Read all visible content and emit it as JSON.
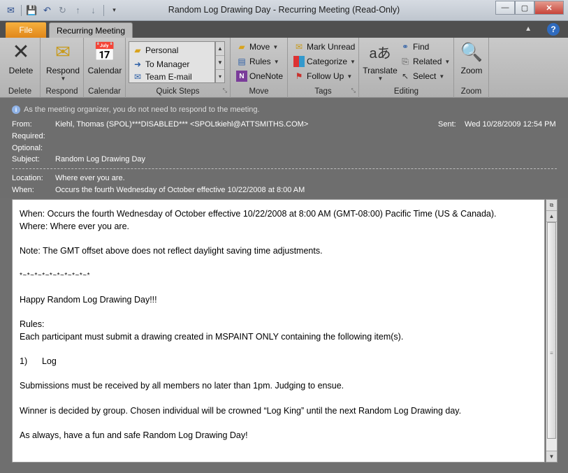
{
  "window": {
    "title": "Random Log Drawing Day  -  Recurring Meeting  (Read-Only)",
    "controls": {
      "minimize": "—",
      "maximize": "▢",
      "close": "✕"
    }
  },
  "tabs": {
    "file": "File",
    "active": "Recurring Meeting",
    "help": "?"
  },
  "ribbon": {
    "delete": {
      "button": "Delete",
      "group": "Delete"
    },
    "respond": {
      "button": "Respond",
      "group": "Respond"
    },
    "calendar": {
      "button": "Calendar",
      "group": "Calendar"
    },
    "quick_steps": {
      "items": [
        "Personal",
        "To Manager",
        "Team E-mail"
      ],
      "group": "Quick Steps"
    },
    "move": {
      "items": [
        "Move",
        "Rules",
        "OneNote"
      ],
      "group": "Move"
    },
    "tags": {
      "items": [
        "Mark Unread",
        "Categorize",
        "Follow Up"
      ],
      "group": "Tags"
    },
    "editing": {
      "translate": "Translate",
      "items": [
        "Find",
        "Related",
        "Select"
      ],
      "group": "Editing"
    },
    "zoom": {
      "button": "Zoom",
      "group": "Zoom"
    }
  },
  "header": {
    "info": "As the meeting organizer, you do not need to respond to the meeting.",
    "from_label": "From:",
    "from_value": "Kiehl, Thomas (SPOL)***DISABLED*** <SPOLtkiehl@ATTSMITHS.COM>",
    "sent_label": "Sent:",
    "sent_value": "Wed 10/28/2009 12:54 PM",
    "required_label": "Required:",
    "optional_label": "Optional:",
    "subject_label": "Subject:",
    "subject_value": "Random Log Drawing Day",
    "location_label": "Location:",
    "location_value": "Where ever you are.",
    "when_label": "When:",
    "when_value": "Occurs the fourth Wednesday of October effective 10/22/2008 at 8:00 AM"
  },
  "body": {
    "line1": "When: Occurs the fourth Wednesday of October effective 10/22/2008 at 8:00 AM (GMT-08:00) Pacific Time (US & Canada).",
    "line2": "Where: Where ever you are.",
    "note": "Note: The GMT offset above does not reflect daylight saving time adjustments.",
    "stars": "*~*~*~*~*~*~*~*~*~*",
    "greeting": "Happy Random Log Drawing Day!!!",
    "rules_title": "Rules:",
    "rules_text": "Each participant must submit a drawing created in MSPAINT ONLY containing the following item(s).",
    "item": "1)      Log",
    "submissions": "Submissions must be received by all members no later than 1pm. Judging to ensue.",
    "winner": "Winner is decided by group. Chosen individual will be crowned “Log King” until the next Random Log Drawing day.",
    "closing": "As always, have a fun and safe Random Log Drawing Day!"
  }
}
